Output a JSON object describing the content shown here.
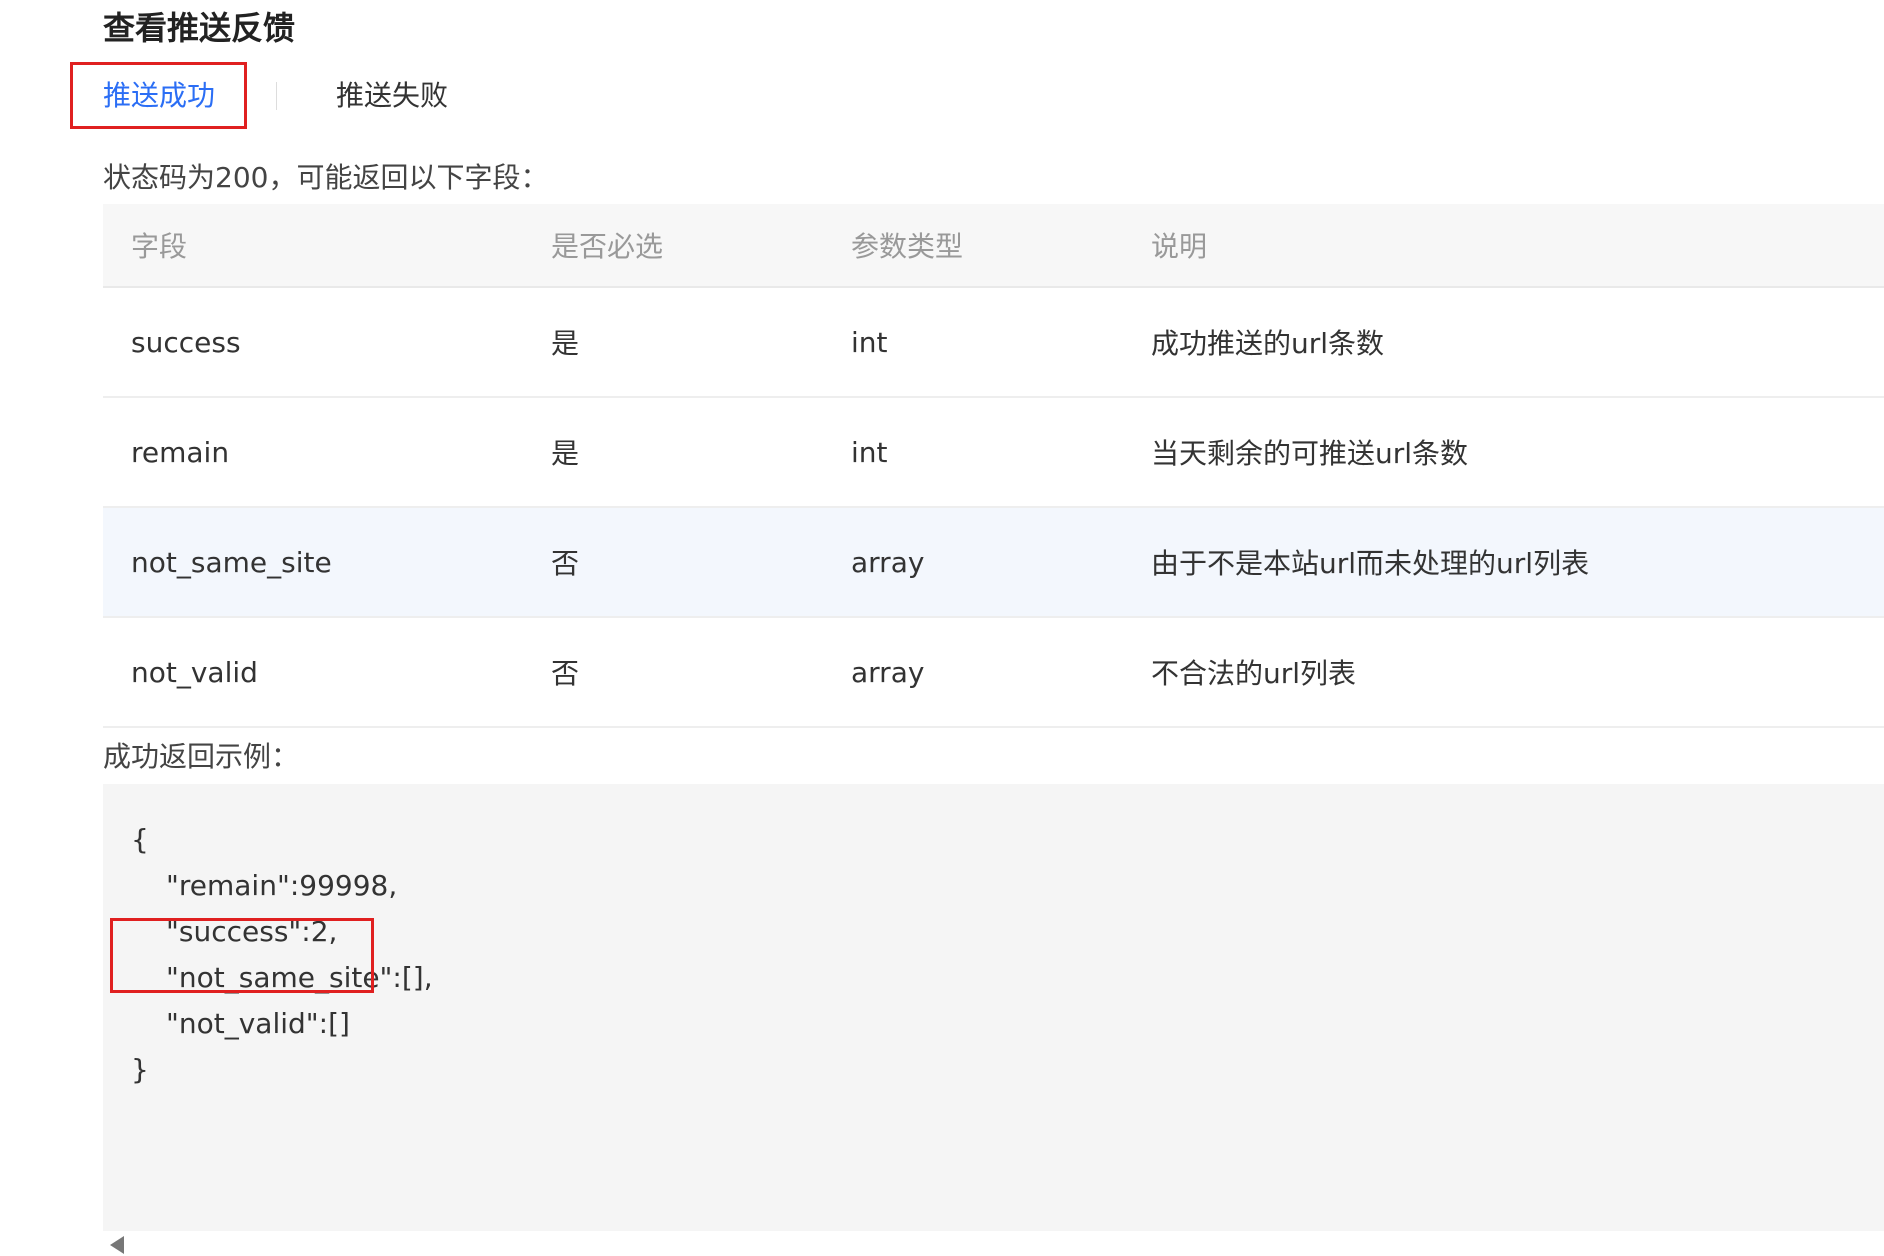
{
  "page": {
    "title": "查看推送反馈"
  },
  "tabs": [
    {
      "label": "推送成功",
      "active": true
    },
    {
      "label": "推送失败",
      "active": false
    }
  ],
  "intro": "状态码为200，可能返回以下字段：",
  "table": {
    "headers": [
      "字段",
      "是否必选",
      "参数类型",
      "说明"
    ],
    "rows": [
      [
        "success",
        "是",
        "int",
        "成功推送的url条数"
      ],
      [
        "remain",
        "是",
        "int",
        "当天剩余的可推送url条数"
      ],
      [
        "not_same_site",
        "否",
        "array",
        "由于不是本站url而未处理的url列表"
      ],
      [
        "not_valid",
        "否",
        "array",
        "不合法的url列表"
      ]
    ]
  },
  "example": {
    "label": "成功返回示例：",
    "lines": [
      "{",
      "\"remain\":99998,",
      "\"success\":2,",
      "\"not_same_site\":[],",
      "\"not_valid\":[]",
      "}"
    ]
  },
  "colors": {
    "accent": "#2b6ef5",
    "highlight_border": "#e02020",
    "code_background": "#f5f5f5",
    "header_background": "#f7f7f7",
    "hover_row": "#f3f7fd"
  },
  "icons": {
    "scroll_left": "scroll-left-arrow-icon"
  }
}
